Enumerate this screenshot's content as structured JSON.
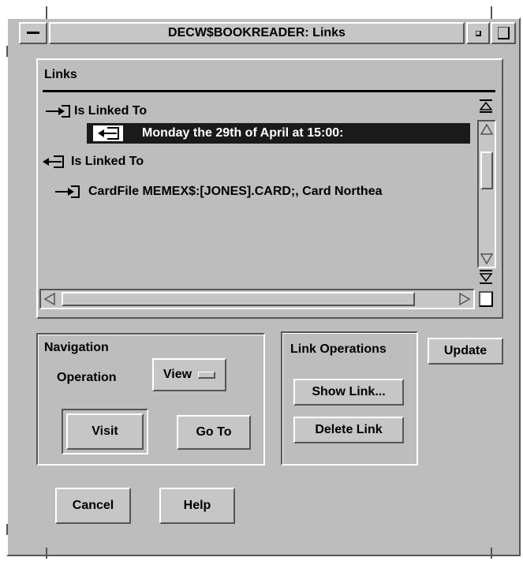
{
  "window": {
    "title": "DECW$BOOKREADER: Links"
  },
  "links": {
    "title": "Links",
    "items": [
      {
        "icon": "link-out-arrow-icon",
        "label": "Is Linked To",
        "selected": false,
        "indent": 0
      },
      {
        "icon": "link-in-arrow-icon",
        "label": "Monday the 29th of April at 15:00:",
        "selected": true,
        "indent": 1
      },
      {
        "icon": "link-in-arrow-icon",
        "label": "Is Linked To",
        "selected": false,
        "indent": 0
      },
      {
        "icon": "link-out-arrow-icon",
        "label": "CardFile MEMEX$:[JONES].CARD;, Card Northea",
        "selected": false,
        "indent": 1
      }
    ]
  },
  "navigation": {
    "title": "Navigation",
    "operation_label": "Operation",
    "operation_value": "View",
    "visit_label": "Visit",
    "goto_label": "Go To"
  },
  "link_operations": {
    "title": "Link Operations",
    "show_link_label": "Show Link...",
    "delete_link_label": "Delete Link"
  },
  "update_label": "Update",
  "cancel_label": "Cancel",
  "help_label": "Help",
  "colors": {
    "background": "#bdbdbd",
    "selection": "#1a1a1a"
  }
}
